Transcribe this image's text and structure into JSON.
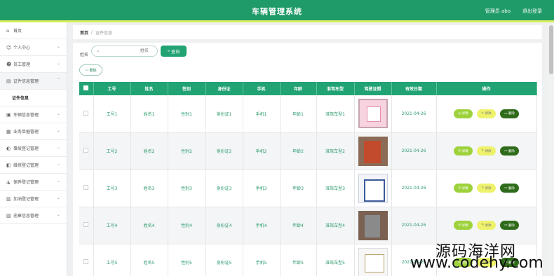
{
  "header": {
    "title": "车辆管理系统",
    "user": "管理员 abo",
    "logout": "退出登录"
  },
  "sidebar": {
    "items": [
      {
        "label": "首页",
        "icon": "home-icon",
        "glyph": "⌂"
      },
      {
        "label": "个人中心",
        "icon": "person-icon",
        "glyph": "☺"
      },
      {
        "label": "员工管理",
        "icon": "staff-icon",
        "glyph": "☻"
      },
      {
        "label": "证件信息管理",
        "icon": "id-icon",
        "glyph": "▤"
      },
      {
        "label": "证件信息",
        "sub": true
      },
      {
        "label": "车辆信息管理",
        "icon": "car-icon",
        "glyph": "▣"
      },
      {
        "label": "业务单据管理",
        "icon": "doc-icon",
        "glyph": "▦"
      },
      {
        "label": "事故登记管理",
        "icon": "accident-icon",
        "glyph": "◐"
      },
      {
        "label": "维修登记管理",
        "icon": "repair-icon",
        "glyph": "◧"
      },
      {
        "label": "保养登记管理",
        "icon": "service-icon",
        "glyph": "◮"
      },
      {
        "label": "加油登记管理",
        "icon": "fuel-icon",
        "glyph": "▥"
      },
      {
        "label": "违章信息管理",
        "icon": "violation-icon",
        "glyph": "▧"
      }
    ]
  },
  "breadcrumb": {
    "home": "首页",
    "sep": "/",
    "current": "证件信息"
  },
  "search": {
    "label": "姓名",
    "placeholder": "姓名",
    "button": "查询"
  },
  "actions": {
    "delete": "删除"
  },
  "table": {
    "headers": [
      "",
      "工号",
      "姓名",
      "性别",
      "身份证",
      "手机",
      "年龄",
      "准驾车型",
      "驾驶证照",
      "有效日期",
      "操作"
    ],
    "rows": [
      [
        "工号1",
        "姓名1",
        "性别1",
        "身份证1",
        "手机1",
        "年龄1",
        "准驾车型1",
        "2021-04-26"
      ],
      [
        "工号2",
        "姓名2",
        "性别2",
        "身份证2",
        "手机2",
        "年龄2",
        "准驾车型2",
        "2021-04-26"
      ],
      [
        "工号3",
        "姓名3",
        "性别3",
        "身份证3",
        "手机3",
        "年龄3",
        "准驾车型3",
        "2021-04-26"
      ],
      [
        "工号4",
        "姓名4",
        "性别4",
        "身份证4",
        "手机4",
        "年龄4",
        "准驾车型4",
        "2021-04-26"
      ],
      [
        "工号5",
        "姓名5",
        "性别5",
        "身份证5",
        "手机5",
        "年龄5",
        "准驾车型5",
        "2021-04-26"
      ]
    ],
    "ops": {
      "detail": "详情",
      "edit": "修改",
      "delete": "删除"
    }
  },
  "watermark": {
    "line1": "源码海洋网",
    "line2": "www.codehy.com"
  },
  "colors": {
    "primary": "#22a374",
    "topbar": "#1f9b68",
    "accent": "#d9ef5e"
  }
}
